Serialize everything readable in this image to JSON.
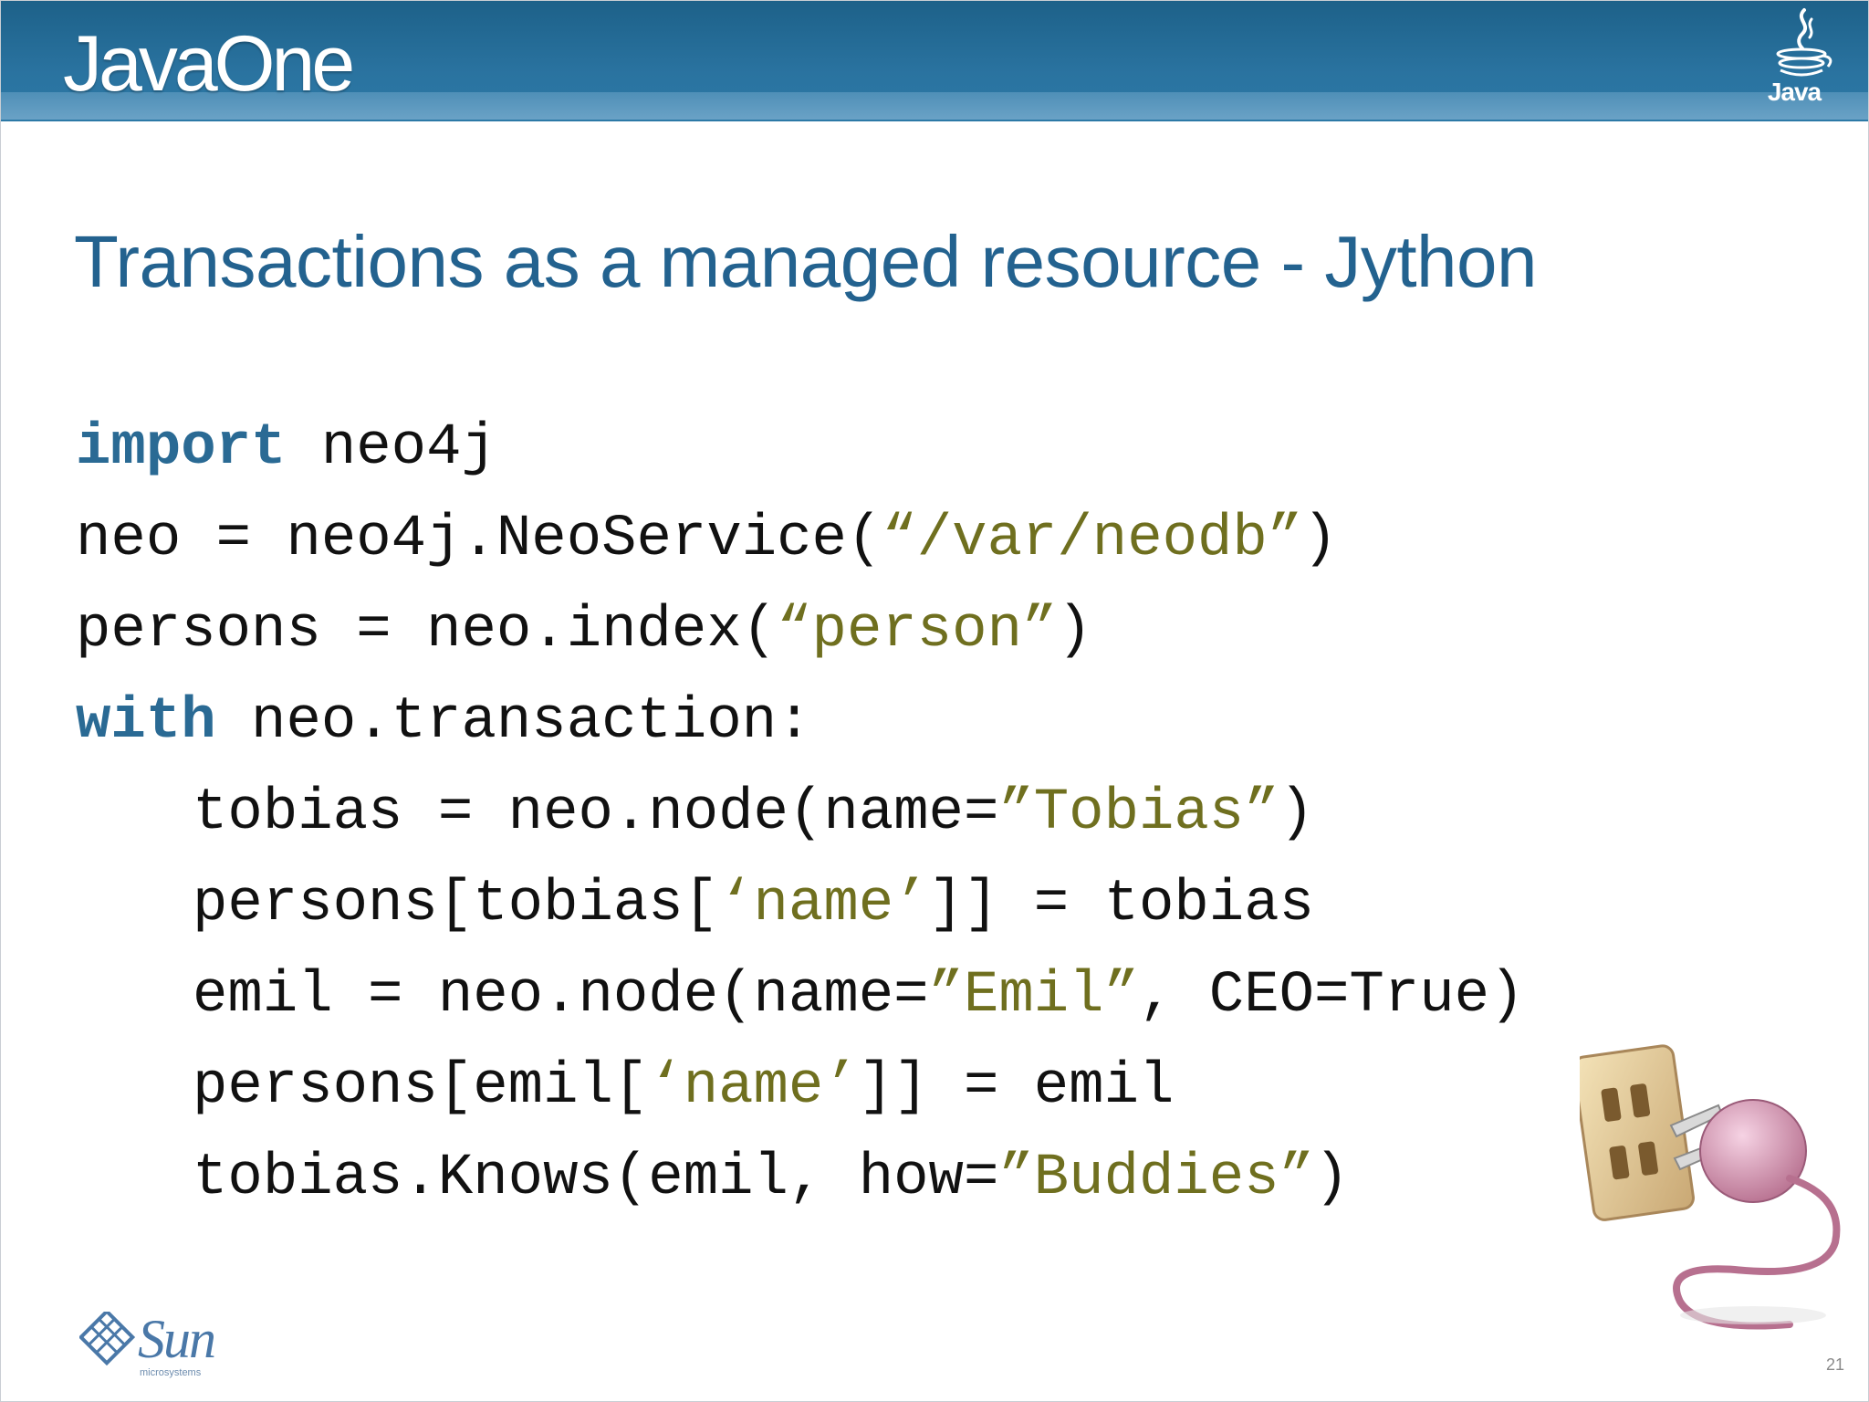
{
  "header": {
    "logo_text": "JavaOne",
    "java_logo_text": "Java"
  },
  "slide": {
    "title": "Transactions as a managed resource - Jython",
    "code_lines": [
      {
        "indent": false,
        "tokens": [
          {
            "t": "import",
            "k": "kw"
          },
          {
            "t": " neo4j",
            "k": "plain"
          }
        ]
      },
      {
        "indent": false,
        "tokens": [
          {
            "t": "neo = neo4j.NeoService(",
            "k": "plain"
          },
          {
            "t": "“/var/neodb”",
            "k": "str"
          },
          {
            "t": ")",
            "k": "plain"
          }
        ]
      },
      {
        "indent": false,
        "tokens": [
          {
            "t": "persons = neo.index(",
            "k": "plain"
          },
          {
            "t": "“person”",
            "k": "str"
          },
          {
            "t": ")",
            "k": "plain"
          }
        ]
      },
      {
        "indent": false,
        "tokens": [
          {
            "t": "with",
            "k": "kw"
          },
          {
            "t": " neo.transaction:",
            "k": "plain"
          }
        ]
      },
      {
        "indent": true,
        "tokens": [
          {
            "t": "tobias = neo.node(name=",
            "k": "plain"
          },
          {
            "t": "”Tobias”",
            "k": "str"
          },
          {
            "t": ")",
            "k": "plain"
          }
        ]
      },
      {
        "indent": true,
        "tokens": [
          {
            "t": "persons[tobias[",
            "k": "plain"
          },
          {
            "t": "‘name’",
            "k": "str"
          },
          {
            "t": "]] = tobias",
            "k": "plain"
          }
        ]
      },
      {
        "indent": true,
        "tokens": [
          {
            "t": "emil = neo.node(name=",
            "k": "plain"
          },
          {
            "t": "”Emil”",
            "k": "str"
          },
          {
            "t": ", CEO=True)",
            "k": "plain"
          }
        ]
      },
      {
        "indent": true,
        "tokens": [
          {
            "t": "persons[emil[",
            "k": "plain"
          },
          {
            "t": "‘name’",
            "k": "str"
          },
          {
            "t": "]] = emil",
            "k": "plain"
          }
        ]
      },
      {
        "indent": true,
        "tokens": [
          {
            "t": "tobias.Knows(emil, how=",
            "k": "plain"
          },
          {
            "t": "”Buddies”",
            "k": "str"
          },
          {
            "t": ")",
            "k": "plain"
          }
        ]
      }
    ]
  },
  "footer": {
    "sun_logo_text": "Sun",
    "sun_logo_subtext": "microsystems",
    "page_number": "21"
  },
  "colors": {
    "header_blue": "#1d6189",
    "title_blue": "#23628f",
    "keyword_blue": "#2a6a94",
    "string_olive": "#6f6f1f",
    "code_black": "#111111"
  }
}
